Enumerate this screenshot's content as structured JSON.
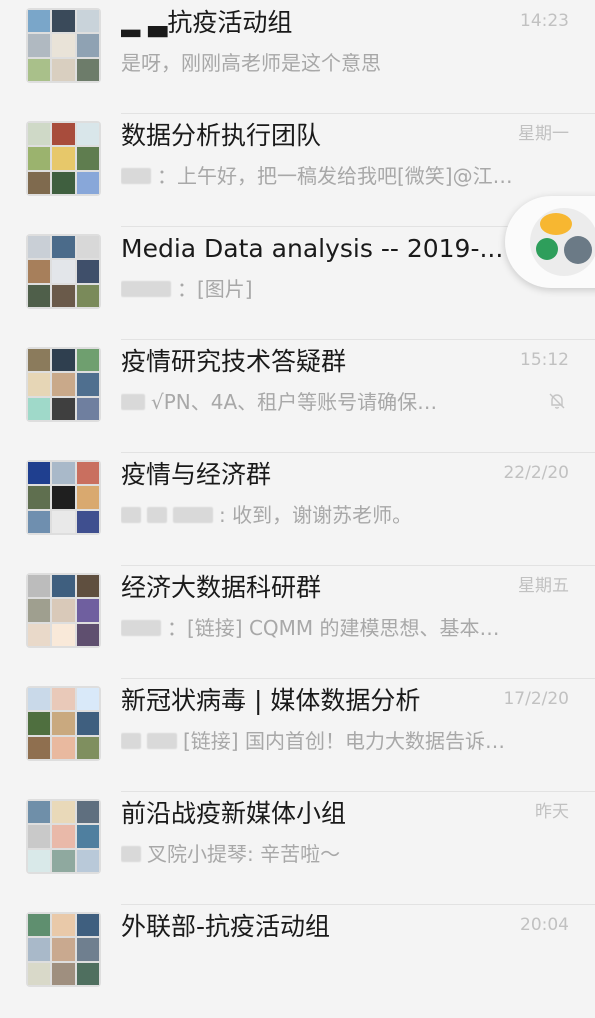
{
  "chats": [
    {
      "title": "▂ ▃抗疫活动组",
      "time": "14:23",
      "preview": "是呀，刚刚高老师是这个意思",
      "blurred": [],
      "muted": false,
      "tiles": [
        "#7aa6c9",
        "#3a4a5a",
        "#c9d3da",
        "#b0b9c1",
        "#e9e3d8",
        "#8fa2b3",
        "#a9c08a",
        "#d9cfc0",
        "#6d7c6a"
      ]
    },
    {
      "title": "数据分析执行团队",
      "time": "星期一",
      "preview": "：上午好，把一稿发给我吧[微笑]@江…",
      "blurred": [
        30
      ],
      "muted": false,
      "tiles": [
        "#cfd9c7",
        "#a84c3c",
        "#d9e6ea",
        "#9bb36e",
        "#e7c86a",
        "#5f7d4f",
        "#7f6a4e",
        "#3f5f3f",
        "#88a7d9"
      ]
    },
    {
      "title": "Media Data analysis -- 2019-...",
      "time": "",
      "preview": "：[图片]",
      "blurred": [
        50
      ],
      "muted": false,
      "tiles": [
        "#c9cfd6",
        "#4b6b8a",
        "#d8d8d8",
        "#a77f5b",
        "#e3e6ea",
        "#3f4f6a",
        "#4f5f4a",
        "#6a5a4a",
        "#7a8a5a"
      ]
    },
    {
      "title": "疫情研究技术答疑群",
      "time": "15:12",
      "preview": "√PN、4A、租户等账号请确保…",
      "blurred": [
        24
      ],
      "muted": true,
      "tiles": [
        "#8b7b5c",
        "#2f3f4f",
        "#6f9f6f",
        "#e6d6b6",
        "#c9a98a",
        "#4f6f8f",
        "#9fd9c9",
        "#3f3f3f",
        "#6f7f9f"
      ]
    },
    {
      "title": "疫情与经济群",
      "time": "22/2/20",
      "preview": ": 收到，谢谢苏老师。",
      "blurred": [
        20,
        20,
        40
      ],
      "muted": false,
      "tiles": [
        "#1f3f8f",
        "#a9b9c9",
        "#c96f5f",
        "#5f6f4f",
        "#1f1f1f",
        "#d9a96f",
        "#6f8faf",
        "#e9e9e9",
        "#3f4f8f"
      ]
    },
    {
      "title": "经济大数据科研群",
      "time": "星期五",
      "preview": "：[链接] CQMM 的建模思想、基本…",
      "blurred": [
        40
      ],
      "muted": false,
      "tiles": [
        "#bcbcbc",
        "#3f5f7f",
        "#5f4f3f",
        "#9f9f8f",
        "#d9c9b9",
        "#6f5f9f",
        "#e9d9c9",
        "#f9e9d9",
        "#5f4f6f"
      ]
    },
    {
      "title": "新冠状病毒 | 媒体数据分析",
      "time": "17/2/20",
      "preview": "[链接] 国内首创！电力大数据告诉…",
      "blurred": [
        20,
        30
      ],
      "muted": false,
      "tiles": [
        "#c9d9e9",
        "#e9c9b9",
        "#d9e9f9",
        "#4f6f3f",
        "#c9a97f",
        "#3f5f7f",
        "#8f6f4f",
        "#e9b99f",
        "#7f8f5f"
      ]
    },
    {
      "title": "前沿战疫新媒体小组",
      "time": "昨天",
      "preview": "叉院小提琴: 辛苦啦～",
      "blurred": [
        20
      ],
      "muted": false,
      "tiles": [
        "#6f8fa9",
        "#e9d9b9",
        "#5f6f7f",
        "#c9c9c9",
        "#e9b9a9",
        "#4f7f9f",
        "#d9e9e9",
        "#8fa99f",
        "#b9c9d9"
      ]
    },
    {
      "title": "外联部-抗疫活动组",
      "time": "20:04",
      "preview": "",
      "blurred": [],
      "muted": false,
      "tiles": [
        "#5f8f6f",
        "#e9c9a9",
        "#3f5f7f",
        "#a9b9c9",
        "#c9a98f",
        "#6f7f8f",
        "#d9d9c9",
        "#9f8f7f",
        "#4f6f5f"
      ]
    }
  ],
  "icons": {
    "mute": "bell-slash-icon",
    "float": "floating-window-icon"
  }
}
